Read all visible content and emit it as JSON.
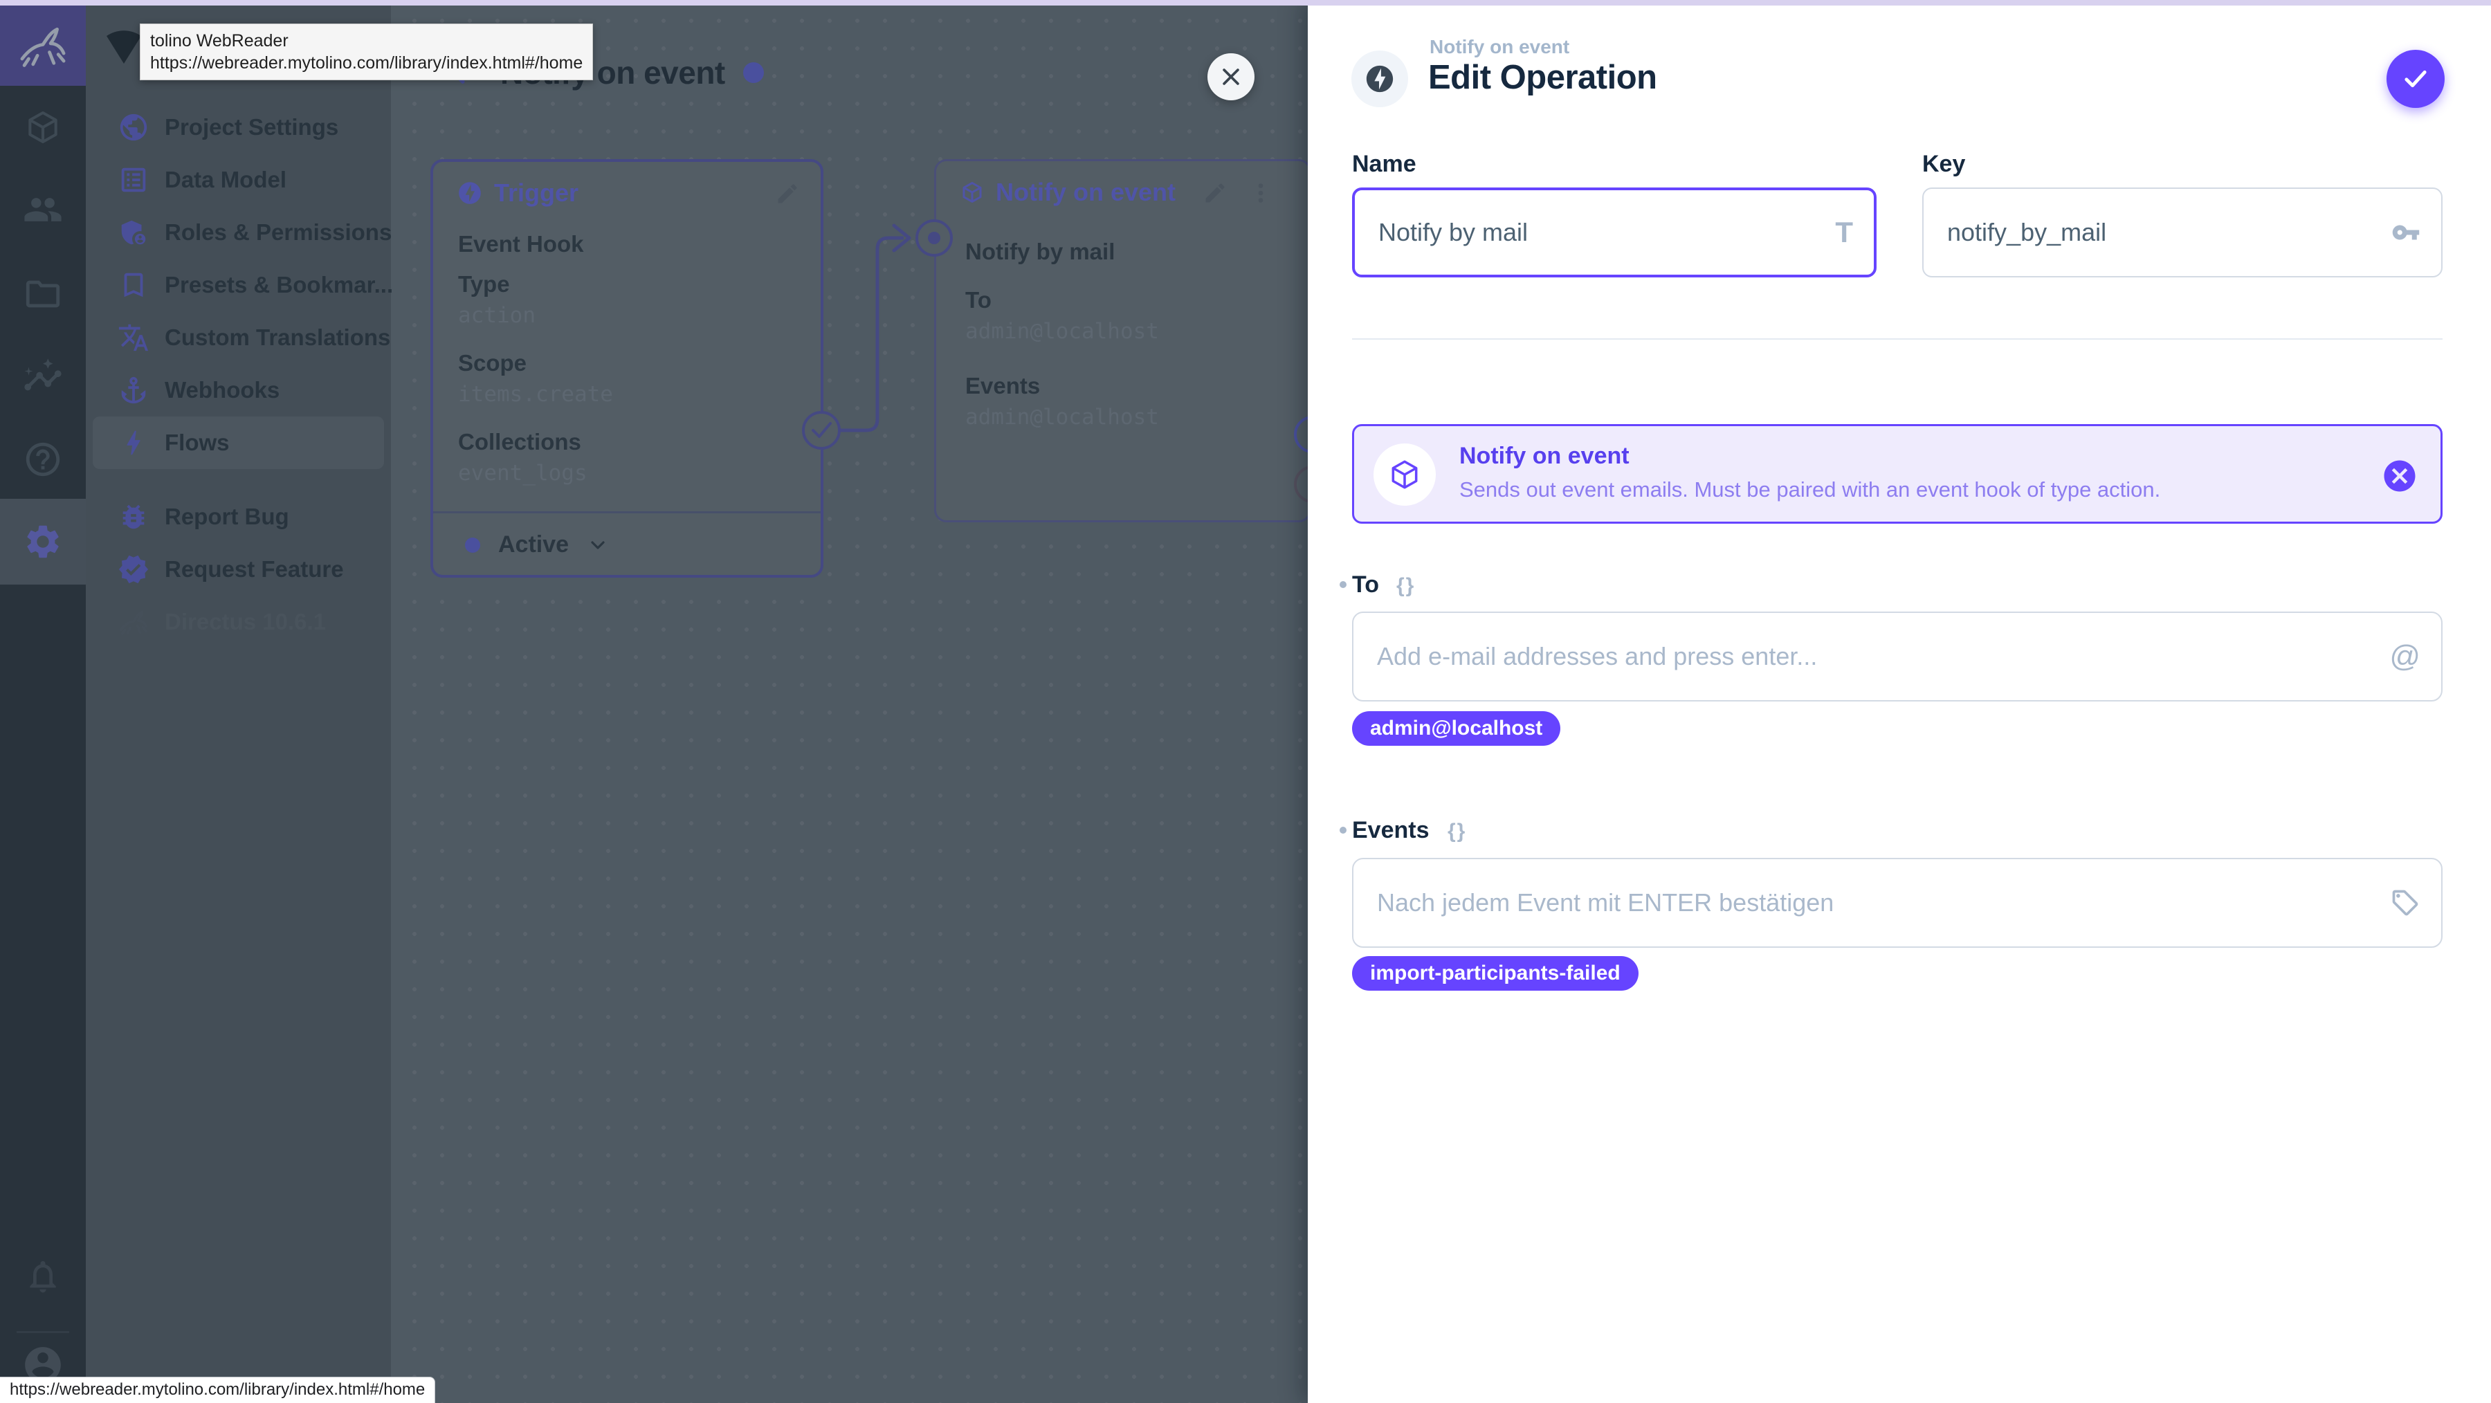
{
  "browser": {
    "tooltip": {
      "title": "tolino WebReader",
      "url": "https://webreader.mytolino.com/library/index.html#/home"
    },
    "statusbar_url": "https://webreader.mytolino.com/library/index.html#/home"
  },
  "module_bar": {
    "icons": [
      "directus-rabbit-logo",
      "box",
      "people",
      "folder",
      "insights",
      "help",
      "settings-active",
      "notifications-bell",
      "account-circle"
    ]
  },
  "sidebar": {
    "items": [
      {
        "label": "Project Settings",
        "icon": "globe"
      },
      {
        "label": "Data Model",
        "icon": "list-alt"
      },
      {
        "label": "Roles & Permissions",
        "icon": "shield-person"
      },
      {
        "label": "Presets & Bookmar...",
        "icon": "bookmark"
      },
      {
        "label": "Custom Translations",
        "icon": "translate"
      },
      {
        "label": "Webhooks",
        "icon": "anchor"
      },
      {
        "label": "Flows",
        "icon": "bolt",
        "active": true
      }
    ],
    "footer_items": [
      {
        "label": "Report Bug",
        "icon": "bug"
      },
      {
        "label": "Request Feature",
        "icon": "verified-badge"
      }
    ],
    "version": "Directus 10.6.1"
  },
  "canvas": {
    "flow_title": "Notify on event",
    "trigger_panel": {
      "title": "Trigger",
      "intro": "Event Hook",
      "fields": [
        {
          "label": "Type",
          "value": "action"
        },
        {
          "label": "Scope",
          "value": "items.create"
        },
        {
          "label": "Collections",
          "value": "event_logs"
        }
      ],
      "status_label": "Active"
    },
    "operation_panel": {
      "title": "Notify on event",
      "intro": "Notify by mail",
      "fields": [
        {
          "label": "To",
          "value": "admin@localhost"
        },
        {
          "label": "Events",
          "value": "admin@localhost"
        }
      ]
    }
  },
  "drawer": {
    "context": "Notify on event",
    "title": "Edit Operation",
    "name_field": {
      "label": "Name",
      "value": "Notify by mail"
    },
    "key_field": {
      "label": "Key",
      "value": "notify_by_mail"
    },
    "operation_info": {
      "title": "Notify on event",
      "description": "Sends out event emails. Must be paired with an event hook of type action."
    },
    "to_field": {
      "label": "To",
      "braces": "{}",
      "placeholder": "Add e-mail addresses and press enter...",
      "chip": "admin@localhost",
      "at_glyph": "@"
    },
    "events_field": {
      "label": "Events",
      "braces": "{}",
      "placeholder": "Nach jedem Event mit ENTER bestätigen",
      "chip": "import-participants-failed"
    },
    "name_suffix_glyph": "T"
  },
  "colors": {
    "accent": "#6644FF",
    "drawer_bg": "#FFFFFF",
    "info_box_bg": "#EFEBFD",
    "info_title": "#5740EE",
    "chip_bg": "#6644FF",
    "title_text": "#16293F",
    "placeholder": "#A9B8CB",
    "module_bar_bg": "#29333C",
    "nav_bg": "#444E57",
    "canvas_bg": "#4F5A63",
    "panel_border_dim": "#454983"
  }
}
